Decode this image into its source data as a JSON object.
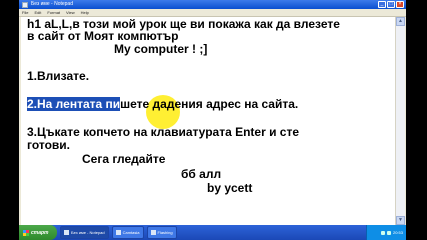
{
  "window": {
    "title": "Без име - Notepad",
    "minimize": "_",
    "maximize": "□",
    "close": "×"
  },
  "menu": [
    "File",
    "Edit",
    "Format",
    "View",
    "Help"
  ],
  "document": {
    "lines": [
      "h1 aL,L,в този мой урок ще ви покажа как да влезете",
      "в сайт от Моят компютър",
      "My computer ! ;]",
      "1.Влизате.",
      "2.На лентата пишете дадения адрес на сайта.",
      "3.Цъкате копчето на клавиатурата Enter и сте",
      "готови.",
      "Сега гледайте",
      "бб алл",
      "by ycett"
    ],
    "selected_text": "2.На лентата пи",
    "unselected_rest": "шете дадения адрес на сайта."
  },
  "taskbar": {
    "start_label": "старт",
    "tasks": [
      "Без име - Notepad",
      "Camtasia",
      "Flashing"
    ],
    "clock": "20:53"
  },
  "colors": {
    "selection": "#1d4fb6",
    "cursor_highlight": "#ffee28",
    "title_bar": "#0a4fd0"
  }
}
